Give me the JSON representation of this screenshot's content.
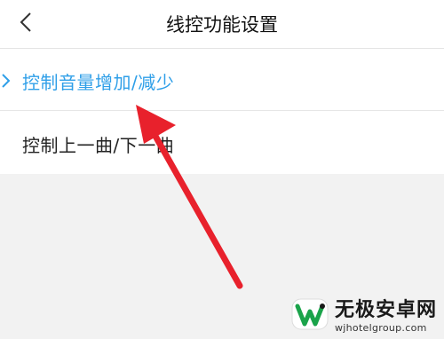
{
  "header": {
    "back_icon": "chevron-left-icon",
    "title": "线控功能设置"
  },
  "settings": {
    "items": [
      {
        "label": "控制音量增加/减少",
        "selected": true,
        "icon": "chevron-right-icon"
      },
      {
        "label": "控制上一曲/下一曲",
        "selected": false
      }
    ]
  },
  "annotation": {
    "icon": "red-arrow-icon",
    "color": "#e8212c"
  },
  "watermark": {
    "name": "无极安卓网",
    "url": "wjhotelgroup.com"
  },
  "colors": {
    "accent": "#2f9fe8",
    "background": "#f2f2f2",
    "arrow": "#e8212c"
  }
}
